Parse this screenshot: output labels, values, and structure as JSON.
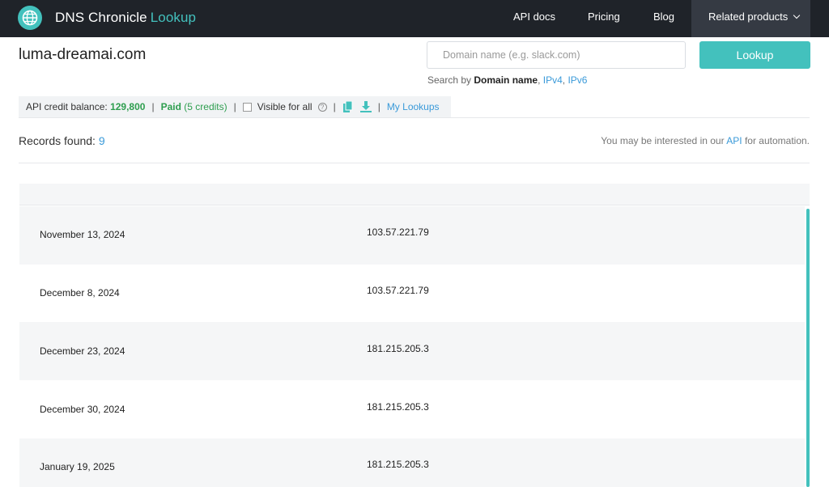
{
  "brand": {
    "name": "DNS Chronicle",
    "accent": "Lookup",
    "accent_color": "#43c1bd",
    "icon": "globe-icon"
  },
  "nav": {
    "api_docs": "API docs",
    "pricing": "Pricing",
    "blog": "Blog",
    "related": "Related products"
  },
  "page": {
    "domain": "luma-dreamai.com"
  },
  "search": {
    "placeholder": "Domain name (e.g. slack.com)",
    "value": "",
    "button": "Lookup",
    "by_prefix": "Search by",
    "by_domain": "Domain name",
    "by_comma1": ",",
    "by_ipv4": "IPv4",
    "by_comma2": ",",
    "by_ipv6": "IPv6"
  },
  "credits": {
    "label": "API credit balance:",
    "balance": "129,800",
    "sep": "|",
    "paid": "Paid",
    "paid_credits": "(5 credits)",
    "visible_label": "Visible for all",
    "help": "?",
    "my_lookups": "My Lookups",
    "visible_checked": false
  },
  "records": {
    "label": "Records found:",
    "count": "9"
  },
  "api_note": {
    "prefix": "You may be interested in our",
    "link": "API",
    "suffix": "for automation."
  },
  "rows": [
    {
      "date": "November 13, 2024",
      "ip": "103.57.221.79"
    },
    {
      "date": "December 8, 2024",
      "ip": "103.57.221.79"
    },
    {
      "date": "December 23, 2024",
      "ip": "181.215.205.3"
    },
    {
      "date": "December 30, 2024",
      "ip": "181.215.205.3"
    },
    {
      "date": "January 19, 2025",
      "ip": "181.215.205.3"
    }
  ]
}
